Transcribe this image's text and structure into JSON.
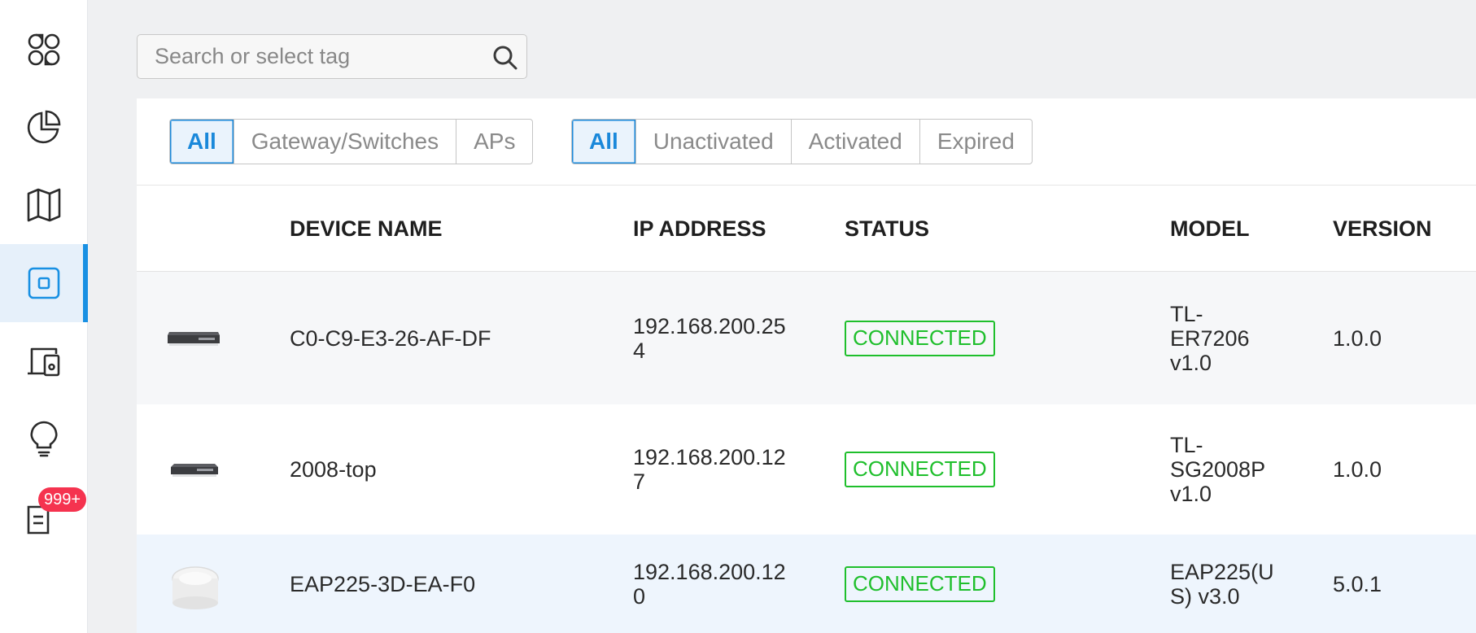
{
  "sidebar": {
    "items": [
      {
        "name": "dashboard-icon"
      },
      {
        "name": "statistics-icon"
      },
      {
        "name": "map-icon"
      },
      {
        "name": "devices-icon",
        "active": true
      },
      {
        "name": "clients-icon"
      },
      {
        "name": "insight-icon"
      },
      {
        "name": "logs-icon",
        "badge": "999+"
      }
    ]
  },
  "search": {
    "placeholder": "Search or select tag"
  },
  "type_filter": [
    "All",
    "Gateway/Switches",
    "APs"
  ],
  "status_filter": [
    "All",
    "Unactivated",
    "Activated",
    "Expired"
  ],
  "table": {
    "headers": {
      "name": "DEVICE NAME",
      "ip": "IP ADDRESS",
      "status": "STATUS",
      "model": "MODEL",
      "version": "VERSION"
    },
    "rows": [
      {
        "icon": "router-image",
        "name": "C0-C9-E3-26-AF-DF",
        "ip_line1": "192.168.200.25",
        "ip_line2": "4",
        "status": "CONNECTED",
        "model_line1": "TL-",
        "model_line2": "ER7206",
        "model_line3": "v1.0",
        "version": "1.0.0"
      },
      {
        "icon": "switch-image",
        "name": "2008-top",
        "ip_line1": "192.168.200.12",
        "ip_line2": "7",
        "status": "CONNECTED",
        "model_line1": "TL-",
        "model_line2": "SG2008P",
        "model_line3": "v1.0",
        "version": "1.0.0"
      },
      {
        "icon": "access-point-image",
        "name": "EAP225-3D-EA-F0",
        "ip_line1": "192.168.200.12",
        "ip_line2": "0",
        "status": "CONNECTED",
        "model_line1": "EAP225(U",
        "model_line2": "S) v3.0",
        "version": "5.0.1"
      }
    ]
  },
  "colors": {
    "accent": "#1a88da",
    "connected": "#1fbf2c",
    "badge": "#f5334f"
  }
}
